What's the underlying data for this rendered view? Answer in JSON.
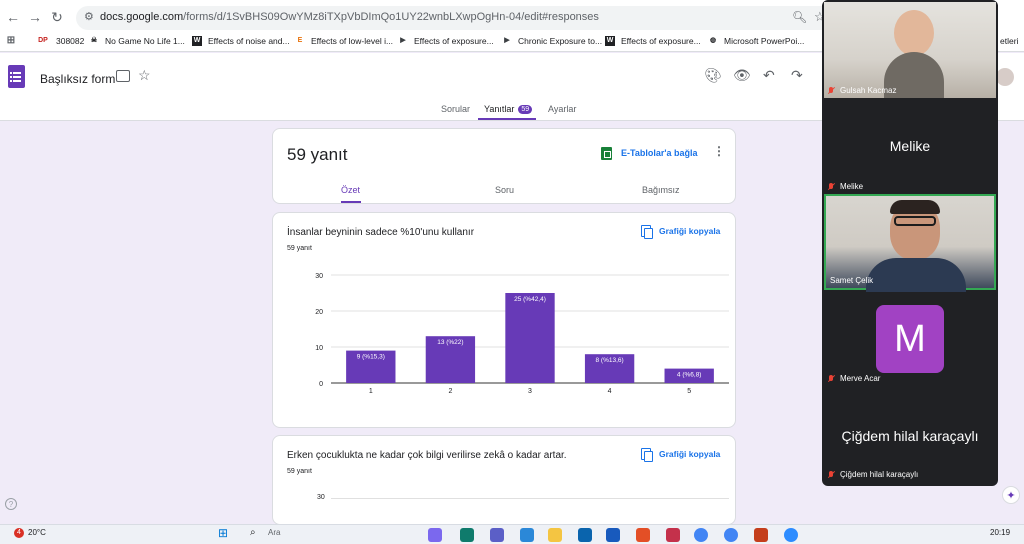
{
  "browser": {
    "url_host": "docs.google.com",
    "url_rest": "/forms/d/1SvBHS09OwYMz8iTXpVbDImQo1UY22wnbLXwpOgHn-04/edit#responses",
    "bookmarks": [
      {
        "label": "308082",
        "icon": "DP"
      },
      {
        "label": "No Game No Life 1...",
        "icon": "skull"
      },
      {
        "label": "Effects of noise and...",
        "icon": "W"
      },
      {
        "label": "Effects of low-level i...",
        "icon": "E"
      },
      {
        "label": "Effects of exposure...",
        "icon": "bookmark"
      },
      {
        "label": "Chronic Exposure to...",
        "icon": "bookmark"
      },
      {
        "label": "Effects of exposure...",
        "icon": "W"
      },
      {
        "label": "Microsoft PowerPoi...",
        "icon": "globe"
      }
    ],
    "bookmarks_overflow": "etleri"
  },
  "form": {
    "title": "Başlıksız form",
    "tabs": {
      "questions": "Sorular",
      "responses": "Yanıtlar",
      "responses_count": "59",
      "settings": "Ayarlar"
    }
  },
  "summary": {
    "title": "59 yanıt",
    "sheets_link": "E-Tablolar'a bağla",
    "subtabs": {
      "summary": "Özet",
      "question": "Soru",
      "individual": "Bağımsız"
    }
  },
  "q1": {
    "title": "İnsanlar beyninin sadece %10'unu kullanır",
    "count": "59 yanıt",
    "copy_label": "Grafiği kopyala"
  },
  "q2": {
    "title": "Erken çocuklukta ne kadar çok bilgi verilirse zekâ o kadar artar.",
    "count": "59 yanıt",
    "copy_label": "Grafiği kopyala",
    "first_tick": "30"
  },
  "chart_data": {
    "type": "bar",
    "categories": [
      "1",
      "2",
      "3",
      "4",
      "5"
    ],
    "values": [
      9,
      13,
      25,
      8,
      4
    ],
    "data_labels": [
      "9 (%15,3)",
      "13 (%22)",
      "25 (%42,4)",
      "8 (%13,6)",
      "4 (%6,8)"
    ],
    "yticks": [
      "0",
      "10",
      "20",
      "30"
    ],
    "ylim": [
      0,
      30
    ],
    "bar_color": "#673ab7",
    "grid": true
  },
  "meet": {
    "participants": [
      {
        "name": "Gulsah Kacmaz",
        "type": "video"
      },
      {
        "name": "Melike",
        "big_name": "Melike",
        "type": "name"
      },
      {
        "name": "Samet Çelik",
        "type": "video",
        "speaking": true
      },
      {
        "name": "Merve Acar",
        "type": "avatar",
        "initial": "M"
      },
      {
        "name": "Çiğdem hilal karaçaylı",
        "big_name": "Çiğdem hilal karaçaylı",
        "type": "name"
      }
    ]
  },
  "taskbar": {
    "weather_badge": "4",
    "temperature": "20°C",
    "search": "Ara",
    "time": "20:19"
  },
  "colors": {
    "brand": "#673ab7",
    "link": "#1a73e8",
    "speaking_border": "#34a853"
  }
}
